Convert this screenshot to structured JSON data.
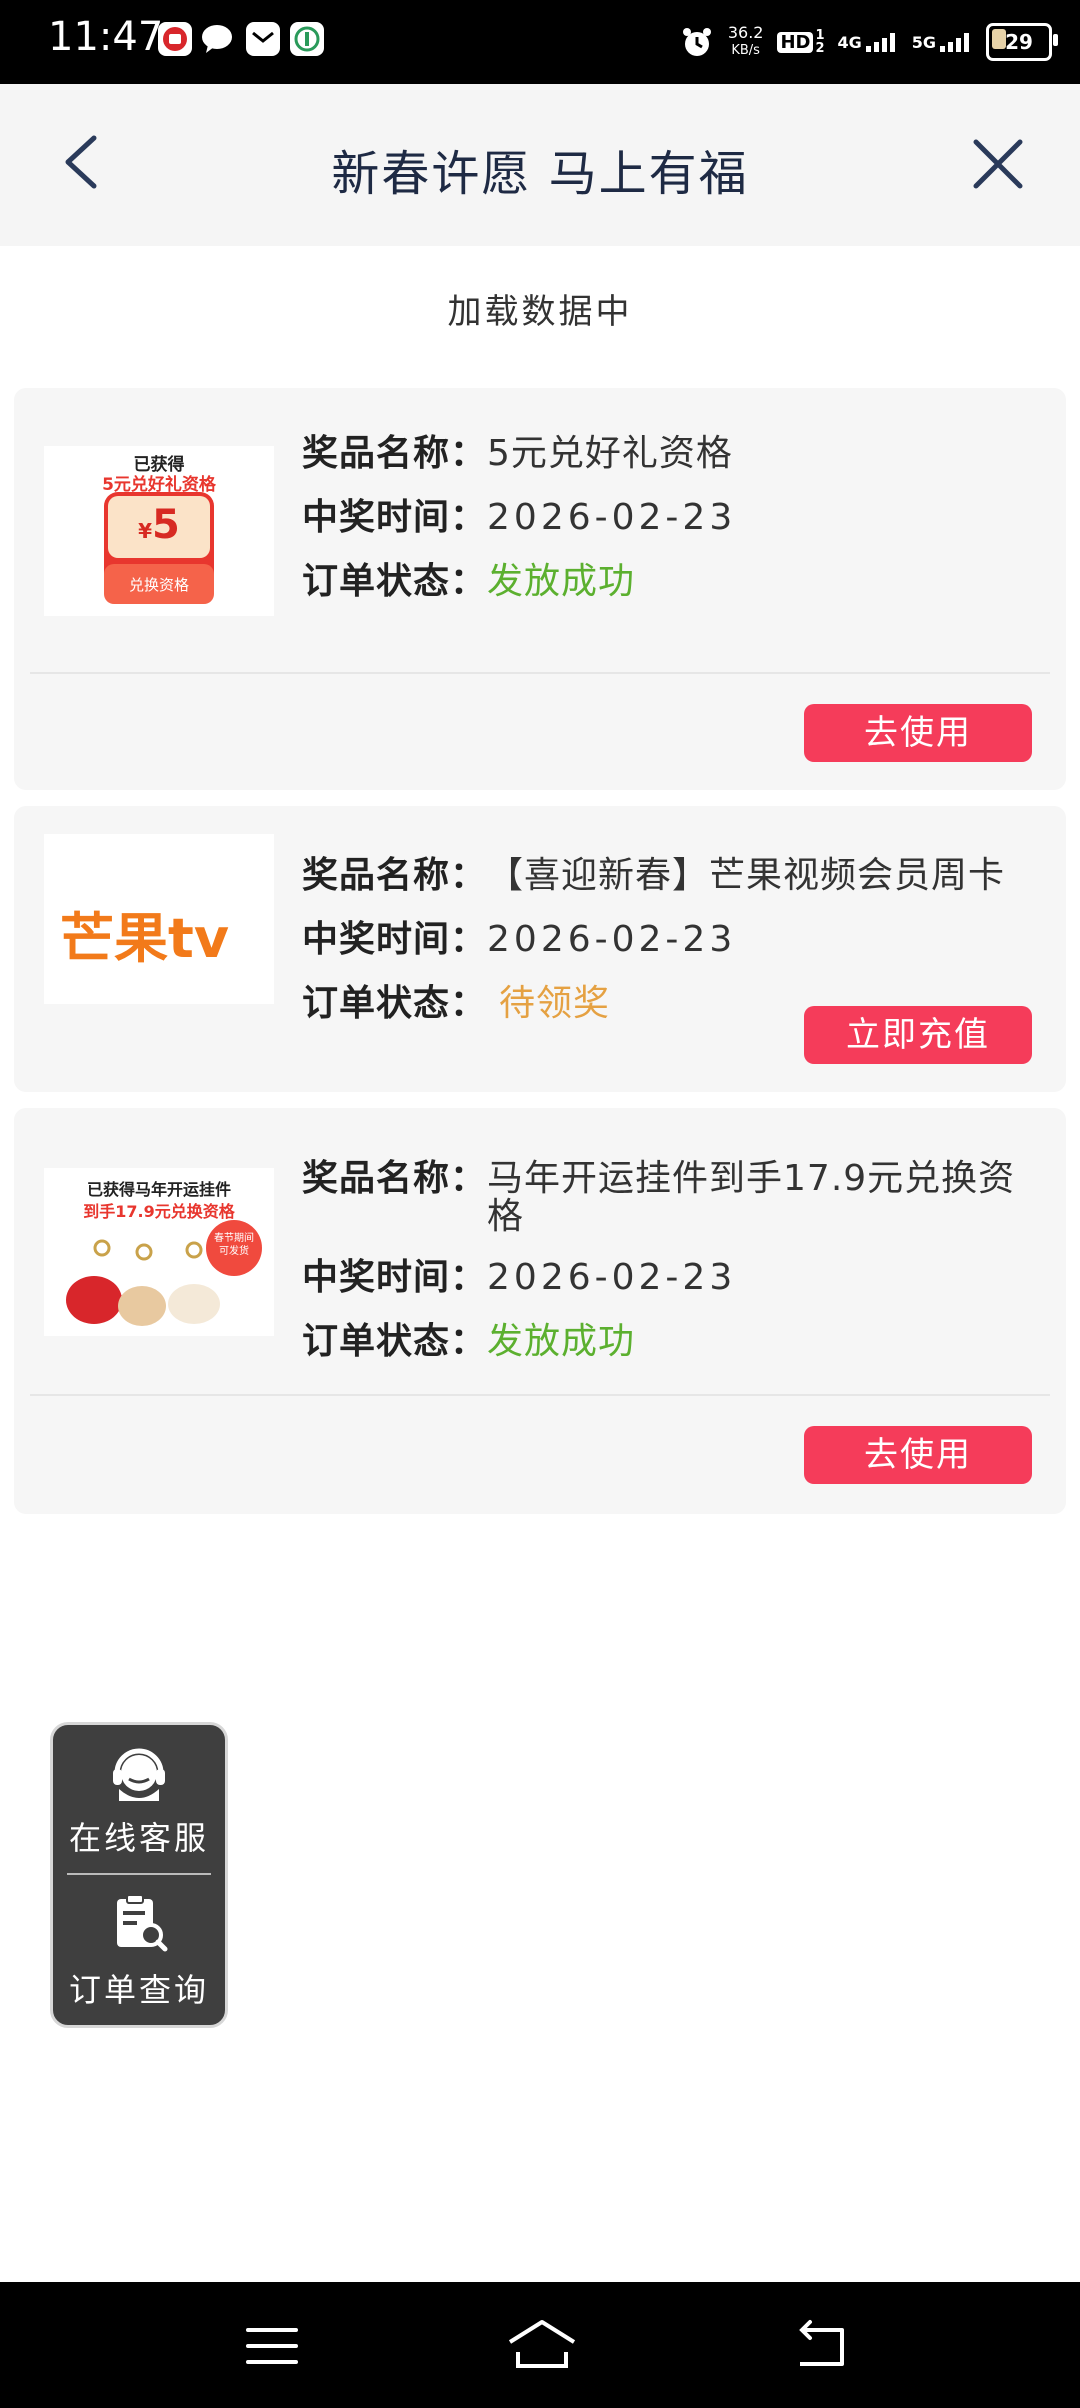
{
  "status_bar": {
    "time": "11:47",
    "net_speed_value": "36.2",
    "net_speed_unit": "KB/s",
    "hd": "HD",
    "hd_sub": "1 2",
    "sig1": "4G",
    "sig2": "5G",
    "battery": "29",
    "icons": [
      "app-badge-icon",
      "chat-bubble-icon",
      "mail-icon",
      "bank-app-icon",
      "alarm-icon",
      "signal-icon",
      "battery-icon"
    ]
  },
  "header": {
    "title": "新春许愿  马上有福",
    "back_icon": "chevron-left-icon",
    "close_icon": "close-icon"
  },
  "loading_text": "加载数据中",
  "labels": {
    "name": "奖品名称：",
    "time": "中奖时间：",
    "status": "订单状态："
  },
  "prizes": [
    {
      "thumb": {
        "line1": "已获得",
        "line2": "5元兑好礼资格",
        "amount_symbol": "¥",
        "amount": "5",
        "caption": "兑换资格"
      },
      "name": "5元兑好礼资格",
      "time": "2026-02-23",
      "status": "发放成功",
      "status_color": "#5cb02f",
      "button": "去使用"
    },
    {
      "thumb": {
        "logo": "芒果tv"
      },
      "name": "【喜迎新春】芒果视频会员周卡",
      "time": "2026-02-23",
      "status": "待领奖",
      "status_color": "#e5a142",
      "button": "立即充值"
    },
    {
      "thumb": {
        "line1": "已获得马年开运挂件",
        "line2": "到手17.9元兑换资格",
        "badge": "春节期间可发货"
      },
      "name": "马年开运挂件到手17.9元兑换资格",
      "time": "2026-02-23",
      "status": "发放成功",
      "status_color": "#5cb02f",
      "button": "去使用"
    }
  ],
  "floater": {
    "service_label": "在线客服",
    "service_icon": "headset-agent-icon",
    "order_label": "订单查询",
    "order_icon": "clipboard-search-icon"
  },
  "bottom_nav": {
    "icons": [
      "menu-icon",
      "home-icon",
      "back-icon"
    ]
  },
  "colors": {
    "accent_button": "#f53c5a",
    "status_success": "#5cb02f",
    "status_pending": "#e5a142",
    "header_bg": "#f5f5f5",
    "card_bg": "#f6f6f6"
  }
}
